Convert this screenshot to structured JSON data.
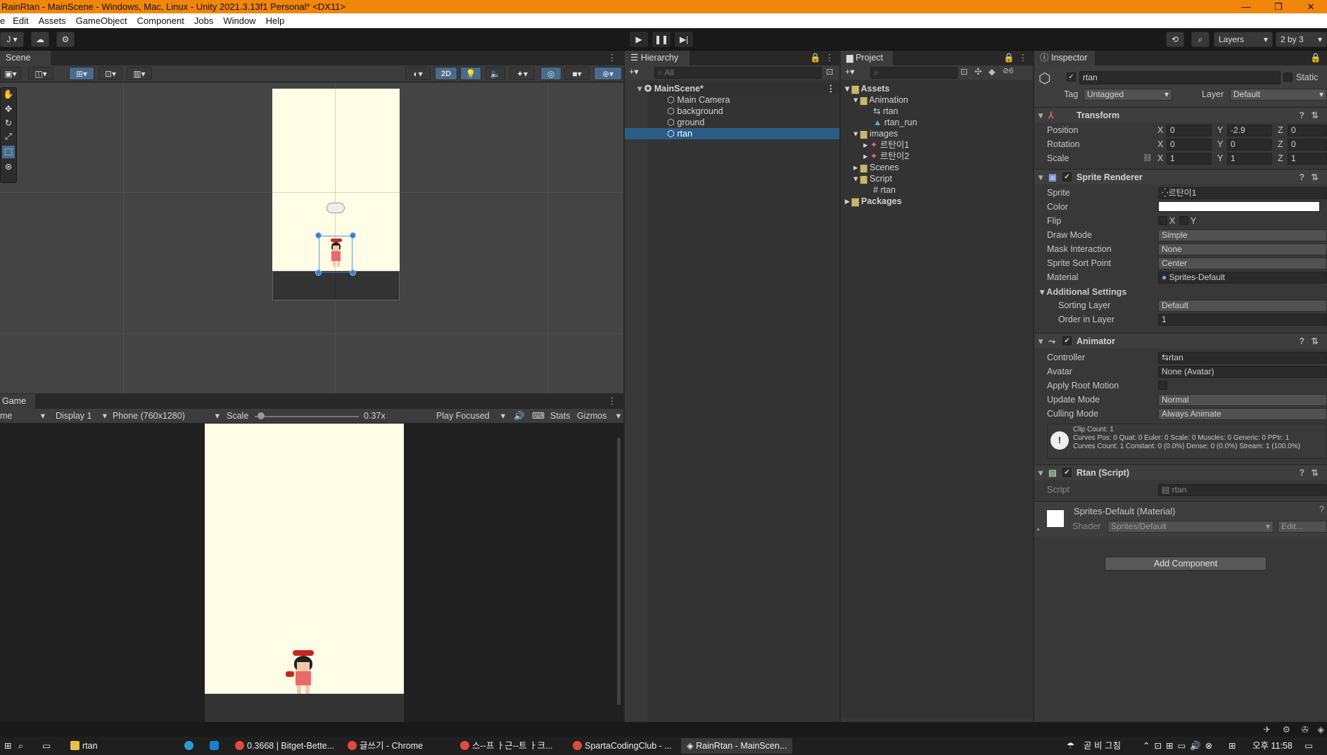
{
  "window": {
    "title": "RainRtan - MainScene - Windows, Mac, Linux - Unity 2021.3.13f1 Personal* <DX11>"
  },
  "menu": [
    "e",
    "Edit",
    "Assets",
    "GameObject",
    "Component",
    "Jobs",
    "Window",
    "Help"
  ],
  "toolbar": {
    "account": "J",
    "layers": "Layers",
    "layout": "2 by 3"
  },
  "scene": {
    "tab": "Scene",
    "mode_2d": "2D"
  },
  "game": {
    "tab": "Game",
    "view": "me",
    "display": "Display 1",
    "resolution": "Phone (760x1280)",
    "scale_label": "Scale",
    "scale_value": "0.37x",
    "play_mode": "Play Focused",
    "stats": "Stats",
    "gizmos": "Gizmos"
  },
  "hierarchy": {
    "tab": "Hierarchy",
    "search_placeholder": "All",
    "scene": "MainScene*",
    "items": [
      "Main Camera",
      "background",
      "ground",
      "rtan"
    ],
    "selected": "rtan"
  },
  "project": {
    "tab": "Project",
    "hidden_count": "6",
    "tree": [
      "Assets",
      "Animation",
      "rtan",
      "rtan_run",
      "images",
      "르탄이1",
      "르탄이2",
      "Scenes",
      "Script",
      "rtan",
      "Packages"
    ]
  },
  "inspector": {
    "tab": "Inspector",
    "object_name": "rtan",
    "static_label": "Static",
    "tag_label": "Tag",
    "tag": "Untagged",
    "layer_label": "Layer",
    "layer": "Default",
    "transform": {
      "title": "Transform",
      "position_label": "Position",
      "rotation_label": "Rotation",
      "scale_label": "Scale",
      "position": [
        "0",
        "-2.9",
        "0"
      ],
      "rotation": [
        "0",
        "0",
        "0"
      ],
      "scale": [
        "1",
        "1",
        "1"
      ],
      "x": "X",
      "y": "Y",
      "z": "Z"
    },
    "sprite_renderer": {
      "title": "Sprite Renderer",
      "sprite_label": "Sprite",
      "sprite": "르탄이1",
      "color_label": "Color",
      "flip_label": "Flip",
      "flip_x": "X",
      "flip_y": "Y",
      "draw_mode_label": "Draw Mode",
      "draw_mode": "Simple",
      "mask_label": "Mask Interaction",
      "mask": "None",
      "sort_point_label": "Sprite Sort Point",
      "sort_point": "Center",
      "material_label": "Material",
      "material": "Sprites-Default",
      "additional": "Additional Settings",
      "sorting_layer_label": "Sorting Layer",
      "sorting_layer": "Default",
      "order_label": "Order in Layer",
      "order": "1",
      "color": "#ffffff"
    },
    "animator": {
      "title": "Animator",
      "controller_label": "Controller",
      "controller": "rtan",
      "avatar_label": "Avatar",
      "avatar": "None (Avatar)",
      "root_motion_label": "Apply Root Motion",
      "update_label": "Update Mode",
      "update": "Normal",
      "culling_label": "Culling Mode",
      "culling": "Always Animate",
      "info": [
        "Clip Count: 1",
        "Curves Pos: 0 Quat: 0 Euler: 0 Scale: 0 Muscles: 0 Generic: 0 PPtr: 1",
        "Curves Count: 1 Constant: 0 (0.0%) Dense: 0 (0.0%) Stream: 1 (100.0%)"
      ]
    },
    "script": {
      "title": "Rtan (Script)",
      "label": "Script",
      "value": "rtan"
    },
    "material": {
      "title": "Sprites-Default (Material)",
      "shader_label": "Shader",
      "shader": "Sprites/Default",
      "edit": "Edit..."
    },
    "add_component": "Add Component"
  },
  "taskbar": {
    "items": [
      "rtan",
      "0.3668 | Bitget-Bette...",
      "글쓰기 - Chrome",
      "스--프 ㅏ근--트 ㅏ크...",
      "SpartaCodingClub - ...",
      "RainRtan - MainScen..."
    ],
    "ime": "곧 비 그침",
    "time": "오후 11:58"
  },
  "colors": {
    "title_bar": "#f0860a",
    "selection": "#2c5d87",
    "scene_bg": "#fffde6",
    "accent_blue": "#3a7fd6"
  }
}
